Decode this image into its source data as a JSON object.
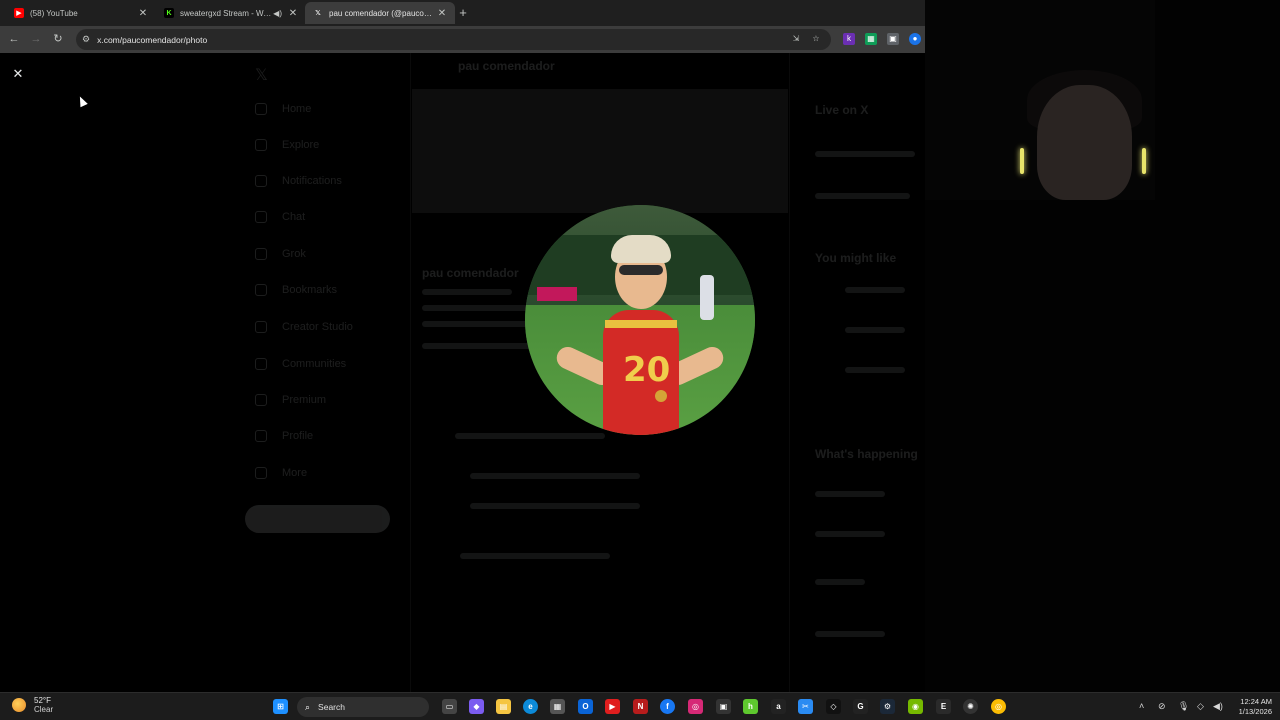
{
  "browser": {
    "tabs": [
      {
        "title": "(58) YouTube",
        "favicon": "youtube-icon",
        "color": "#ff0000",
        "active": false,
        "audio": false
      },
      {
        "title": "sweatergxd Stream - Watch",
        "favicon": "kick-icon",
        "color": "#53fc18",
        "active": false,
        "audio": true
      },
      {
        "title": "pau comendador (@paucomendador)",
        "favicon": "x-icon",
        "color": "#ffffff",
        "active": true,
        "audio": false
      }
    ],
    "new_tab_label": "+",
    "url": "x.com/paucomendador/photo"
  },
  "modal": {
    "close_label": "✕",
    "photo_alt": "Profile photo"
  },
  "background_page": {
    "profile_name": "pau comendador",
    "nav_items": [
      "Home",
      "Explore",
      "Notifications",
      "Chat",
      "Grok",
      "Bookmarks",
      "Creator Studio",
      "Communities",
      "Premium",
      "Profile",
      "More"
    ],
    "right_headings": [
      "Live on X",
      "You might like",
      "What's happening"
    ]
  },
  "taskbar": {
    "weather_temp": "52°F",
    "weather_condition": "Clear",
    "search_label": "Search",
    "time": "12:24 AM",
    "date": "1/13/2026"
  }
}
